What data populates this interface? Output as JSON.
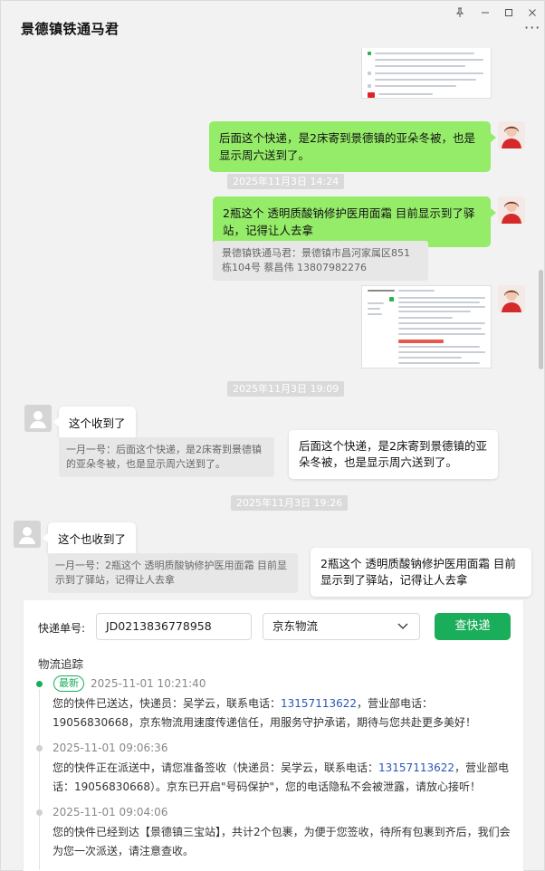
{
  "window": {
    "title": "景德镇铁通马君",
    "controls": {
      "pin": "pin-icon",
      "minimize": "minimize-icon",
      "maximize": "maximize-icon",
      "close": "close-icon",
      "more": "more-icon"
    }
  },
  "chat": {
    "messages": {
      "m1": {
        "text": "后面这个快递，是2床寄到景德镇的亚朵冬被，也是显示周六送到了。"
      },
      "t1": {
        "text": "2025年11月3日 14:24"
      },
      "m2": {
        "text": "2瓶这个 透明质酸钠修护医用面霜 目前显示到了驿站，记得让人去拿"
      },
      "q2": {
        "text": "景德镇铁通马君：景德镇市昌河家属区851栋104号 蔡昌伟 13807982276"
      },
      "t2": {
        "text": "2025年11月3日 19:09"
      },
      "m3": {
        "text": "这个收到了"
      },
      "q3": {
        "text": "一月一号：后面这个快递，是2床寄到景德镇的亚朵冬被，也是显示周六送到了。"
      },
      "p3": {
        "text": "后面这个快递，是2床寄到景德镇的亚朵冬被，也是显示周六送到了。"
      },
      "t3": {
        "text": "2025年11月3日 19:26"
      },
      "m4": {
        "text": "这个也收到了"
      },
      "q4": {
        "text": "一月一号：2瓶这个 透明质酸钠修护医用面霜 目前显示到了驿站，记得让人去拿"
      },
      "p4": {
        "text": "2瓶这个 透明质酸钠修护医用面霜 目前显示到了驿站，记得让人去拿"
      }
    }
  },
  "tracking": {
    "label": "快递单号:",
    "number": "JD0213836778958",
    "carrier": "京东物流",
    "query_button": "查快递",
    "section_title": "物流追踪",
    "events": [
      {
        "tag": "最新",
        "time": "2025-11-01 10:21:40",
        "text_a": "您的快件已送达，快递员：吴学云，联系电话：",
        "phone_a": "13157113622",
        "text_b": "，营业部电话：19056830668，京东物流用速度传递信任，用服务守护承诺，期待与您共赴更多美好！"
      },
      {
        "time": "2025-11-01 09:06:36",
        "text_a": "您的快件正在派送中，请您准备签收（快递员：吴学云，联系电话：",
        "phone_a": "13157113622",
        "text_b": "，营业部电话：19056830668）。京东已开启\"号码保护\"，您的电话隐私不会被泄露，请放心接听！"
      },
      {
        "time": "2025-11-01 09:04:06",
        "text_a": "您的快件已经到达【景德镇三宝站】，共计2个包裹，为便于您签收，待所有包裹到齐后，我们会为您一次派送，请注意查收。"
      }
    ],
    "colors": {
      "accent": "#1aad5a",
      "phone": "#2b56b6"
    }
  }
}
